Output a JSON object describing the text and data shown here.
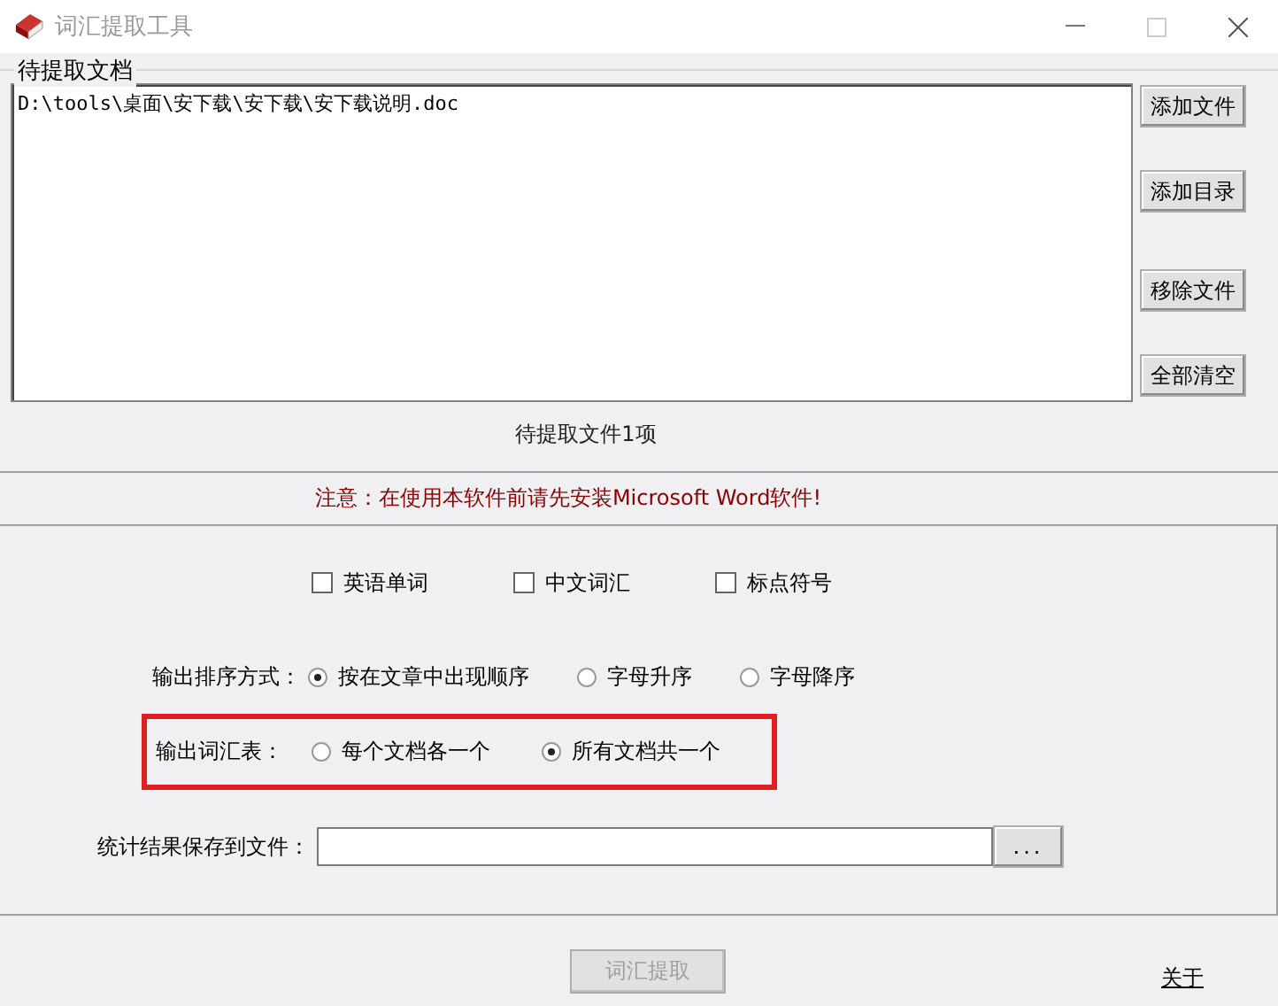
{
  "window": {
    "title": "词汇提取工具"
  },
  "document_group": {
    "title": "待提取文档",
    "files": [
      "D:\\tools\\桌面\\安下载\\安下载\\安下载说明.doc"
    ],
    "buttons": [
      "添加文件",
      "添加目录",
      "移除文件",
      "全部清空"
    ],
    "count": "待提取文件1项"
  },
  "notice": "注意：在使用本软件前请先安装Microsoft Word软件!",
  "options": {
    "checkboxes": [
      {
        "label": "英语单词",
        "checked": false
      },
      {
        "label": "中文词汇",
        "checked": false
      },
      {
        "label": "标点符号",
        "checked": false
      }
    ],
    "sort": {
      "label": "输出排序方式：",
      "choices": [
        {
          "label": "按在文章中出现顺序",
          "selected": true
        },
        {
          "label": "字母升序",
          "selected": false
        },
        {
          "label": "字母降序",
          "selected": false
        }
      ]
    },
    "output_list": {
      "label": "输出词汇表：",
      "highlighted": true,
      "choices": [
        {
          "label": "每个文档各一个",
          "selected": false
        },
        {
          "label": "所有文档共一个",
          "selected": true
        }
      ]
    },
    "save": {
      "label": "统计结果保存到文件：",
      "browse": "..."
    }
  },
  "footer": {
    "extract": {
      "label": "词汇提取",
      "disabled": true
    },
    "about": "关于"
  }
}
